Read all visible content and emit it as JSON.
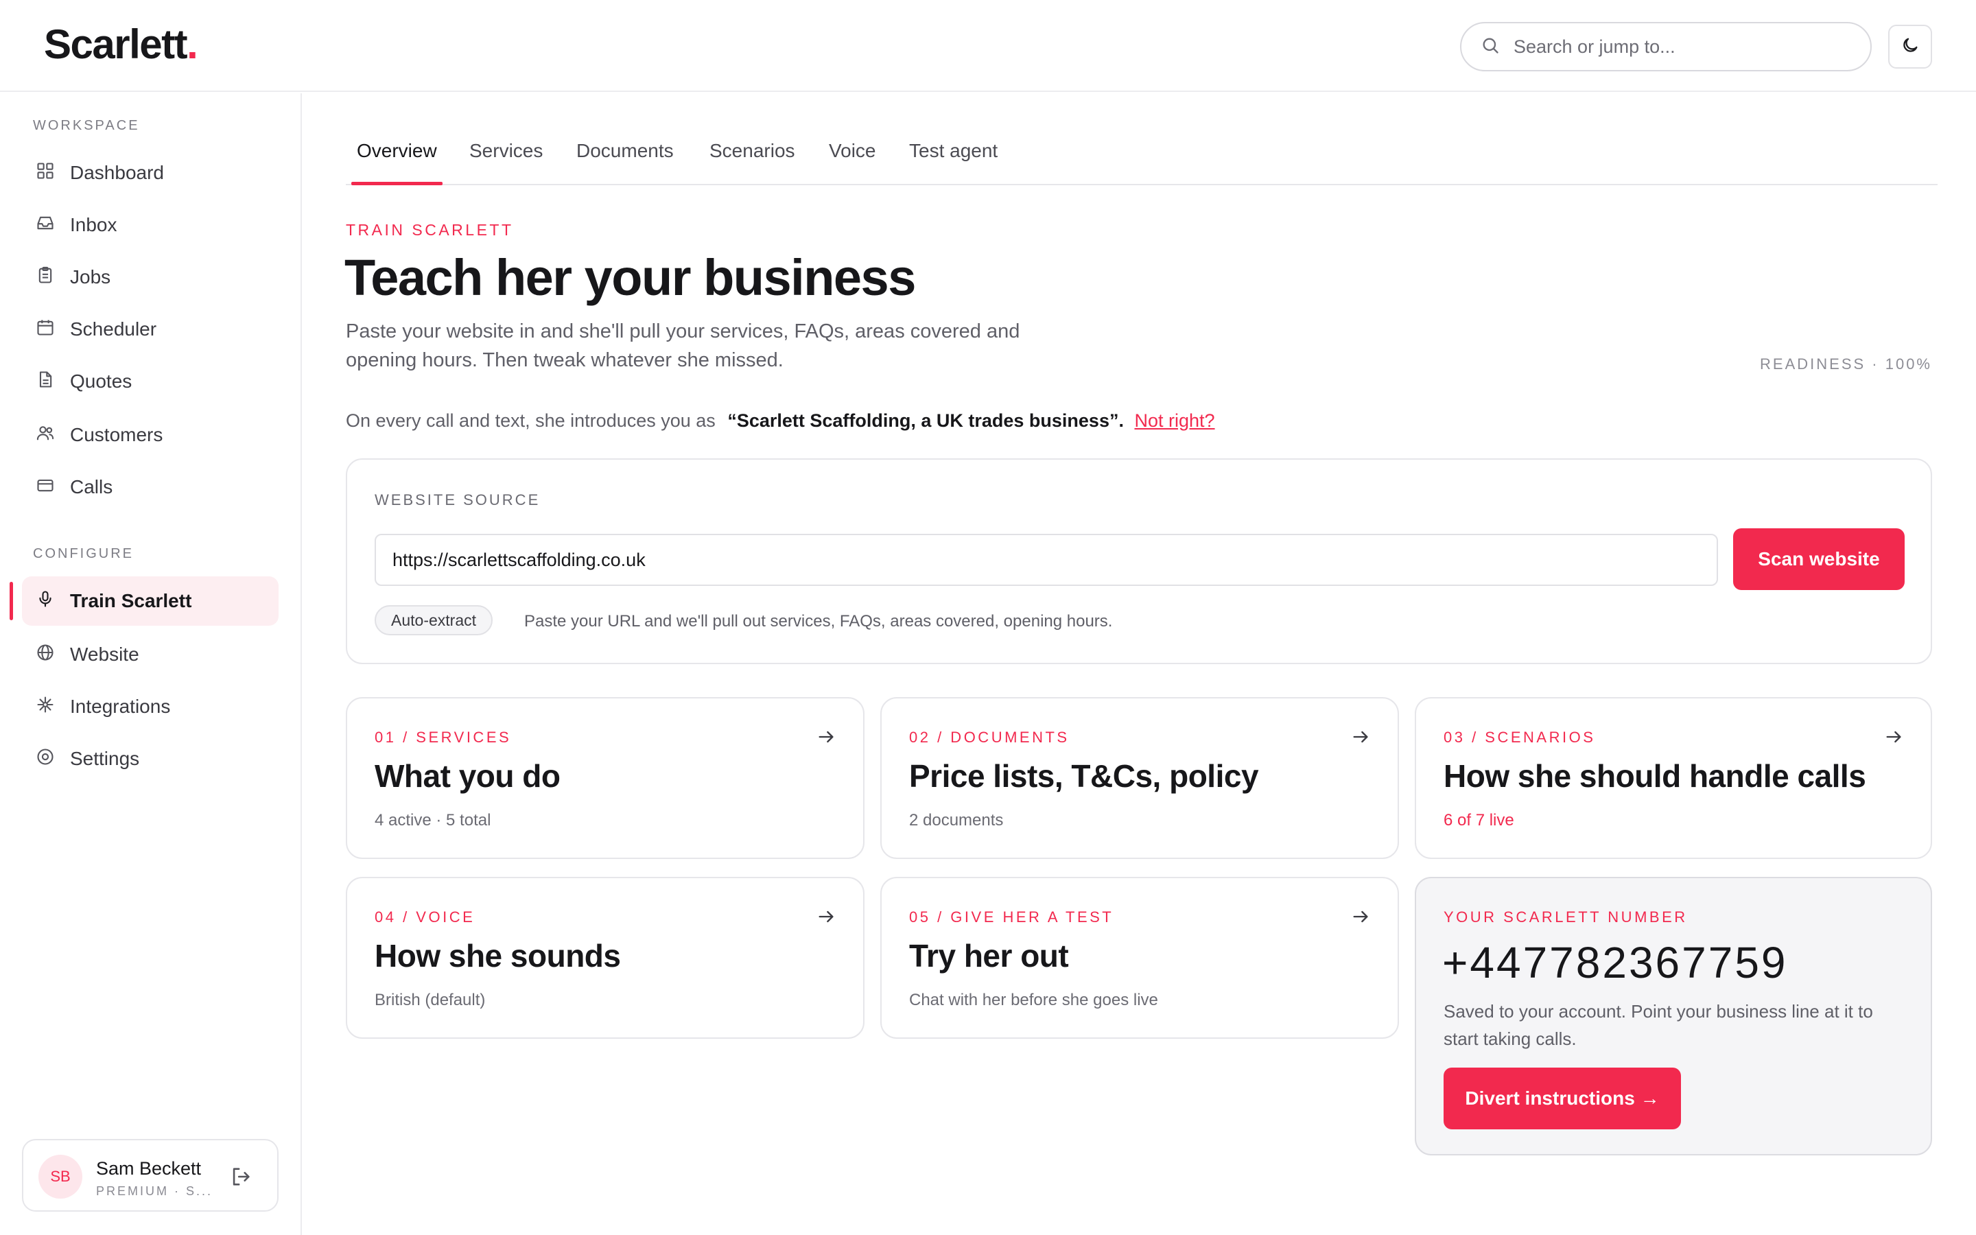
{
  "brand": {
    "name": "Scarlett",
    "dot": ".",
    "accent": "#f2294e"
  },
  "header": {
    "search_placeholder": "Search or jump to..."
  },
  "sidebar": {
    "workspace_label": "WORKSPACE",
    "workspace_items": [
      {
        "label": "Dashboard",
        "icon": "grid-icon"
      },
      {
        "label": "Inbox",
        "icon": "inbox-icon"
      },
      {
        "label": "Jobs",
        "icon": "clipboard-icon"
      },
      {
        "label": "Scheduler",
        "icon": "calendar-icon"
      },
      {
        "label": "Quotes",
        "icon": "document-icon"
      },
      {
        "label": "Customers",
        "icon": "users-icon"
      },
      {
        "label": "Calls",
        "icon": "card-icon"
      }
    ],
    "configure_label": "CONFIGURE",
    "configure_items": [
      {
        "label": "Train Scarlett",
        "icon": "microphone-icon",
        "active": true
      },
      {
        "label": "Website",
        "icon": "globe-icon"
      },
      {
        "label": "Integrations",
        "icon": "sparkle-icon"
      },
      {
        "label": "Settings",
        "icon": "settings-icon"
      }
    ],
    "user": {
      "initials": "SB",
      "name": "Sam Beckett",
      "plan": "PREMIUM · S..."
    }
  },
  "tabs": [
    "Overview",
    "Services",
    "Documents",
    "Scenarios",
    "Voice",
    "Test agent"
  ],
  "active_tab": "Overview",
  "hero": {
    "eyebrow": "TRAIN SCARLETT",
    "title": "Teach her your business",
    "description": "Paste your website in and she'll pull your services, FAQs, areas covered and opening hours. Then tweak whatever she missed.",
    "readiness": "READINESS · 100%",
    "intro_prefix": "On every call and text, she introduces you as",
    "intro_quote": "“Scarlett Scaffolding, a UK trades business”.",
    "intro_link": "Not right?"
  },
  "website_source": {
    "label": "WEBSITE SOURCE",
    "url": "https://scarlettscaffolding.co.uk",
    "scan_button": "Scan website",
    "pill": "Auto-extract",
    "note": "Paste your URL and we'll pull out services, FAQs, areas covered, opening hours."
  },
  "steps": [
    {
      "label": "01 / SERVICES",
      "title": "What you do",
      "meta": "4 active · 5 total",
      "meta_highlight": false
    },
    {
      "label": "02 / DOCUMENTS",
      "title": "Price lists, T&Cs, policy",
      "meta": "2 documents",
      "meta_highlight": false
    },
    {
      "label": "03 / SCENARIOS",
      "title": "How she should handle calls",
      "meta": "6 of 7 live",
      "meta_highlight": true
    },
    {
      "label": "04 / VOICE",
      "title": "How she sounds",
      "meta": "British (default)",
      "meta_highlight": false
    },
    {
      "label": "05 / GIVE HER A TEST",
      "title": "Try her out",
      "meta": "Chat with her before she goes live",
      "meta_highlight": false
    }
  ],
  "number_card": {
    "label": "YOUR SCARLETT NUMBER",
    "number": "+447782367759",
    "description": "Saved to your account. Point your business line at it to start taking calls.",
    "button": "Divert instructions →"
  }
}
